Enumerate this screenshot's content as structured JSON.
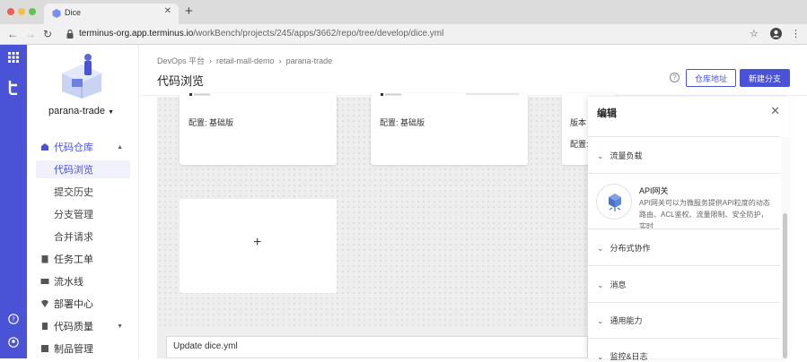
{
  "browser": {
    "tab_title": "Dice",
    "tab_close": "✕",
    "new_tab": "+",
    "url_host": "terminus-org.app.terminus.io",
    "url_path": "/workBench/projects/245/apps/3662/repo/tree/develop/dice.yml"
  },
  "sidebar": {
    "project_name": "parana-trade",
    "menu": [
      {
        "label": "代码仓库",
        "active": true
      },
      {
        "label": "任务工单"
      },
      {
        "label": "流水线"
      },
      {
        "label": "部署中心"
      },
      {
        "label": "代码质量"
      },
      {
        "label": "制品管理"
      }
    ],
    "submenu": [
      {
        "label": "代码浏览",
        "active": true
      },
      {
        "label": "提交历史"
      },
      {
        "label": "分支管理"
      },
      {
        "label": "合并请求"
      }
    ]
  },
  "header": {
    "breadcrumb": [
      "DevOps 平台",
      "retail-mall-demo",
      "parana-trade"
    ],
    "title": "代码浏览",
    "repo_address_button": "仓库地址",
    "new_branch_button": "新建分支",
    "help": "?"
  },
  "canvas": {
    "cards": [
      {
        "config": "配置: 基础版"
      },
      {
        "config": "配置: 基础版"
      },
      {
        "version": "版本",
        "config": "配置:"
      }
    ],
    "add_symbol": "+"
  },
  "commit": {
    "message": "Update dice.yml"
  },
  "panel": {
    "title": "编辑",
    "close": "✕",
    "groups": [
      {
        "label": "流量负载"
      },
      {
        "label": "分布式协作"
      },
      {
        "label": "消息"
      },
      {
        "label": "通用能力"
      },
      {
        "label": "监控&日志"
      }
    ],
    "api_gateway": {
      "title": "API网关",
      "description": "API网关可以为微服务提供API粒度的动态路由、ACL鉴权、流量限制、安全防护，实时"
    }
  }
}
